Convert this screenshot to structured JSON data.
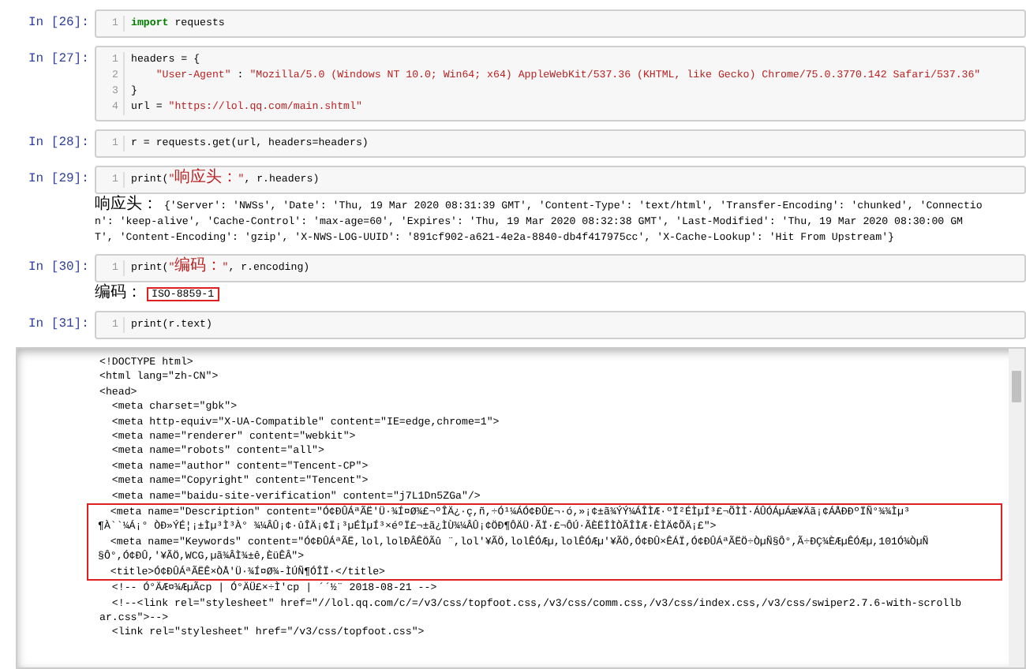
{
  "cells": [
    {
      "prompt": "In [26]:",
      "lines": [
        {
          "number": "1",
          "tokens": [
            {
              "kind": "keyword",
              "text": "import"
            },
            {
              "kind": "plain",
              "text": " requests"
            }
          ]
        }
      ]
    },
    {
      "prompt": "In [27]:",
      "lines": [
        {
          "number": "1",
          "tokens": [
            {
              "kind": "plain",
              "text": "headers = {"
            }
          ]
        },
        {
          "number": "2",
          "tokens": [
            {
              "kind": "string",
              "text": "    \"User-Agent\""
            },
            {
              "kind": "plain",
              "text": " : "
            },
            {
              "kind": "string",
              "text": "\"Mozilla/5.0 (Windows NT 10.0; Win64; x64) AppleWebKit/537.36 (KHTML, like Gecko) Chrome/75.0.3770.142 Safari/537.36\""
            }
          ]
        },
        {
          "number": "3",
          "tokens": [
            {
              "kind": "plain",
              "text": "}"
            }
          ]
        },
        {
          "number": "4",
          "tokens": [
            {
              "kind": "plain",
              "text": "url = "
            },
            {
              "kind": "string",
              "text": "\"https://lol.qq.com/main.shtml\""
            }
          ]
        }
      ]
    },
    {
      "prompt": "In [28]:",
      "lines": [
        {
          "number": "1",
          "tokens": [
            {
              "kind": "plain",
              "text": "r = requests.get(url, headers=headers)"
            }
          ]
        }
      ]
    },
    {
      "prompt": "In [29]:",
      "lines": [
        {
          "number": "1",
          "tokens": [
            {
              "kind": "plain",
              "text": "print("
            },
            {
              "kind": "string",
              "text": "\""
            },
            {
              "kind": "string_cjk",
              "text": "响应头："
            },
            {
              "kind": "string",
              "text": "\""
            },
            {
              "kind": "plain",
              "text": ", r.headers)"
            }
          ]
        }
      ],
      "output": [
        [
          {
            "kind": "cjk",
            "text": "响应头："
          },
          {
            "kind": "plain",
            "text": " {'Server': 'NWSs', 'Date': 'Thu, 19 Mar 2020 08:31:39 GMT', 'Content-Type': 'text/html', 'Transfer-Encoding': 'chunked', 'Connectio"
          }
        ],
        [
          {
            "kind": "plain",
            "text": "n': 'keep-alive', 'Cache-Control': 'max-age=60', 'Expires': 'Thu, 19 Mar 2020 08:32:38 GMT', 'Last-Modified': 'Thu, 19 Mar 2020 08:30:00 GM"
          }
        ],
        [
          {
            "kind": "plain",
            "text": "T', 'Content-Encoding': 'gzip', 'X-NWS-LOG-UUID': '891cf902-a621-4e2a-8840-db4f417975cc', 'X-Cache-Lookup': 'Hit From Upstream'}"
          }
        ]
      ]
    },
    {
      "prompt": "In [30]:",
      "lines": [
        {
          "number": "1",
          "tokens": [
            {
              "kind": "plain",
              "text": "print("
            },
            {
              "kind": "string",
              "text": "\""
            },
            {
              "kind": "string_cjk",
              "text": "编码："
            },
            {
              "kind": "string",
              "text": "\""
            },
            {
              "kind": "plain",
              "text": ", r.encoding)"
            }
          ]
        }
      ],
      "output": [
        [
          {
            "kind": "cjk",
            "text": "编码："
          },
          {
            "kind": "boxed",
            "text": "ISO-8859-1"
          }
        ]
      ]
    },
    {
      "prompt": "In [31]:",
      "lines": [
        {
          "number": "1",
          "tokens": [
            {
              "kind": "plain",
              "text": "print(r.text)"
            }
          ]
        }
      ]
    }
  ],
  "scroll_output": {
    "lines": [
      {
        "text": "<!DOCTYPE html>",
        "highlighted": false
      },
      {
        "text": "<html lang=\"zh-CN\">",
        "highlighted": false
      },
      {
        "text": "<head>",
        "highlighted": false
      },
      {
        "text": "  <meta charset=\"gbk\">",
        "highlighted": false
      },
      {
        "text": "  <meta http-equiv=\"X-UA-Compatible\" content=\"IE=edge,chrome=1\">",
        "highlighted": false
      },
      {
        "text": "  <meta name=\"renderer\" content=\"webkit\">",
        "highlighted": false
      },
      {
        "text": "  <meta name=\"robots\" content=\"all\">",
        "highlighted": false
      },
      {
        "text": "  <meta name=\"author\" content=\"Tencent-CP\">",
        "highlighted": false
      },
      {
        "text": "  <meta name=\"Copyright\" content=\"Tencent\">",
        "highlighted": false
      },
      {
        "text": "  <meta name=\"baidu-site-verification\" content=\"j7L1Dn5ZGa\"/>",
        "highlighted": false
      },
      {
        "text": "  <meta name=\"Description\" content=\"Ó¢ÐÛÁªÃË'Ü·¾Í¤Ø¾£¬ºÎÄ¿·ç,ñ,÷Ó¹¼ÁÓ¢ÐÛ£¬·ó,»¡¢±ã¾ÝÝ¼ÁÎÌÆ·ºÏ²ÉÌµÍ³£¬ÕÌÌ·ÁÛÓÁµÁæ¥Äã¡¢ÁÅÐÐºÏÑ°¾¾Ìµ³",
        "highlighted": true
      },
      {
        "text": "¶À``¼Á¡° ÒÐ»ÝÉ¦¡±Ìµ³Ì³À° ¾¼ÂÛ¡¢·ûÎÄ¡¢Ï¡³µÉÌµÍ³×éºÏ£¬±ã¿ÌÙ¾¼ÂÛ¡¢ÖÐ¶ÔÄÜ·ÃÏ·£¬ÔÚ·ÃÈËÎÌÒÃÎÌÆ·ÈÌÄ¢ÕÄ¡£\">",
        "highlighted": true
      },
      {
        "text": "  <meta name=\"Keywords\" content=\"Ó¢ÐÛÁªÃË,lol,lolÐÂÊÖÃû ¨,lol'¥ÃÖ,lolÊÓÆµ,lolÊÓÆµ'¥ÃÖ,Ó¢ÐÛ×ÊÁÏ,Ó¢ÐÛÁªÃËÖ÷ÒµÑ§Ô°,Ã÷ÐÇ¾ÈÆµÊÓÆµ,101Ó¾ÒµÑ",
        "highlighted": true
      },
      {
        "text": "§Ô°,Ó¢ÐÛ,'¥ÃÖ,WCG,µã¾ÂÌ¾±ê,ÈüÊÂ\">",
        "highlighted": true
      },
      {
        "text": "  <title>Ó¢ÐÛÁªÃËÊ×ÒÅ'Ü·¾Í¤Ø¾-ÌÚÑ¶ÓÎÏ·</title>",
        "highlighted": true
      },
      {
        "text": "  <!-- Ó°ÄÆ¤¾ÆµÃcp | Ó°ÄÜ£×÷Ì'cp | ´´½¨ 2018-08-21 -->",
        "highlighted": false
      },
      {
        "text": "  <!--<link rel=\"stylesheet\" href=\"//lol.qq.com/c/=/v3/css/topfoot.css,/v3/css/comm.css,/v3/css/index.css,/v3/css/swiper2.7.6-with-scrollb",
        "highlighted": false
      },
      {
        "text": "ar.css\">-->",
        "highlighted": false
      },
      {
        "text": "  <link rel=\"stylesheet\" href=\"/v3/css/topfoot.css\">",
        "highlighted": false
      }
    ]
  }
}
